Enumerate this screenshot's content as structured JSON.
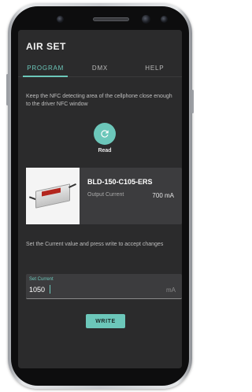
{
  "app": {
    "title": "AIR SET"
  },
  "tabs": [
    {
      "label": "PROGRAM",
      "active": true
    },
    {
      "label": "DMX",
      "active": false
    },
    {
      "label": "HELP",
      "active": false
    }
  ],
  "program": {
    "instruction": "Keep the NFC detecting area of the cellphone close enough to the driver NFC window",
    "read_button": {
      "icon": "refresh-icon",
      "label": "Read"
    },
    "product": {
      "name": "BLD-150-C105-ERS",
      "current_label": "Output Current",
      "current_value": "700 mA"
    },
    "instruction2": "Set the Current value and press write to accept changes",
    "set_current": {
      "label": "Set Current",
      "value": "1050",
      "unit": "mA"
    },
    "write_button": {
      "label": "WRITE"
    }
  },
  "colors": {
    "accent": "#6cc7ba",
    "screen_bg": "#2b2b2c",
    "card_bg": "#3c3c3e"
  }
}
